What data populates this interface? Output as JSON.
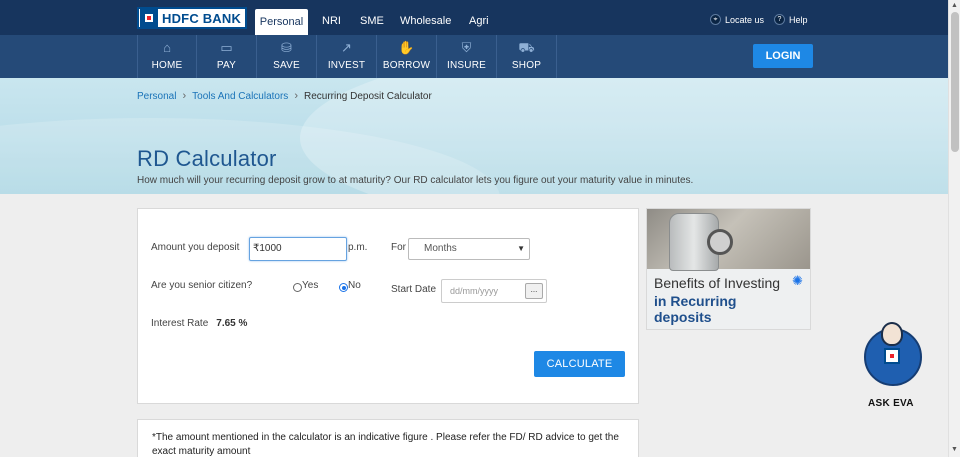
{
  "header": {
    "logo_text": "HDFC BANK",
    "tabs": [
      {
        "label": "Personal",
        "active": true
      },
      {
        "label": "NRI",
        "active": false
      },
      {
        "label": "SME",
        "active": false
      },
      {
        "label": "Wholesale",
        "active": false
      },
      {
        "label": "Agri",
        "active": false
      }
    ],
    "locate_label": "Locate us",
    "help_label": "Help",
    "locate_icon": "map-pin-icon",
    "help_icon": "question-icon"
  },
  "nav": {
    "items": [
      {
        "label": "HOME",
        "icon": "home-icon"
      },
      {
        "label": "PAY",
        "icon": "card-icon"
      },
      {
        "label": "SAVE",
        "icon": "piggy-bank-icon"
      },
      {
        "label": "INVEST",
        "icon": "chart-icon"
      },
      {
        "label": "BORROW",
        "icon": "hand-money-icon"
      },
      {
        "label": "INSURE",
        "icon": "shield-hand-icon"
      },
      {
        "label": "SHOP",
        "icon": "cart-icon"
      }
    ],
    "login_label": "LOGIN"
  },
  "breadcrumb": {
    "items": [
      "Personal",
      "Tools And Calculators",
      "Recurring Deposit Calculator"
    ]
  },
  "hero": {
    "title": "RD Calculator",
    "subtitle": "How much will your recurring deposit grow to at maturity? Our RD calculator lets you figure out your maturity value in minutes."
  },
  "calculator": {
    "amount_label": "Amount you deposit",
    "amount_value": "₹1000",
    "amount_suffix": "p.m.",
    "for_label": "For",
    "for_selected": "Months",
    "senior_label": "Are you senior citizen?",
    "yes_label": "Yes",
    "no_label": "No",
    "senior_selected": "No",
    "start_date_label": "Start Date",
    "start_date_placeholder": "dd/mm/yyyy",
    "date_button_label": "...",
    "rate_label": "Interest Rate",
    "rate_value": "7.65 %",
    "calculate_label": "CALCULATE"
  },
  "note": {
    "text": "*The amount mentioned in the calculator is an indicative figure . Please refer the FD/ RD advice to get the exact maturity amount"
  },
  "promo": {
    "line1": "Benefits of Investing",
    "line2": "in Recurring deposits",
    "icon": "lightbulb-icon"
  },
  "eva": {
    "label": "ASK EVA"
  },
  "colors": {
    "top_bar": "#17355e",
    "nav_bar": "#254a78",
    "accent_button": "#1e88e5",
    "title_blue": "#1f5790",
    "link_blue": "#1a73b8"
  }
}
